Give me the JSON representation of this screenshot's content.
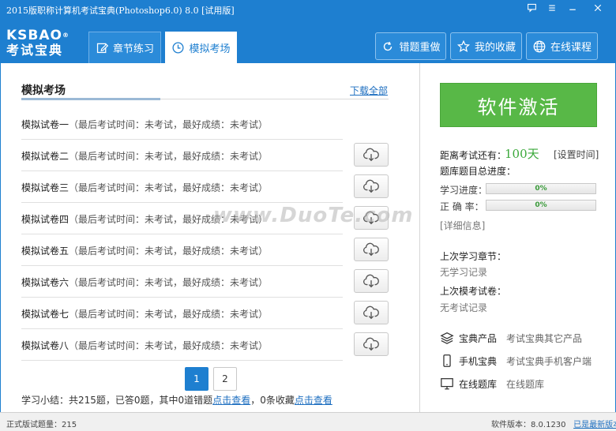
{
  "window": {
    "title": "2015版职称计算机考试宝典(Photoshop6.0) 8.0 [试用版]"
  },
  "logo": {
    "line1": "KSBAO",
    "line2": "考试宝典",
    "reg": "®"
  },
  "tabs": [
    {
      "label": "章节练习",
      "icon": "edit-icon",
      "active": false
    },
    {
      "label": "模拟考场",
      "icon": "clock-icon",
      "active": true
    }
  ],
  "header_buttons": [
    {
      "label": "错题重做",
      "icon": "refresh-icon"
    },
    {
      "label": "我的收藏",
      "icon": "star-icon"
    },
    {
      "label": "在线课程",
      "icon": "globe-icon"
    }
  ],
  "section": {
    "title": "模拟考场",
    "download_all": "下载全部"
  },
  "exams": [
    {
      "name": "模拟试卷一",
      "info": "（最后考试时间：未考试，最好成绩：未考试）",
      "download": false
    },
    {
      "name": "模拟试卷二",
      "info": "（最后考试时间：未考试，最好成绩：未考试）",
      "download": true
    },
    {
      "name": "模拟试卷三",
      "info": "（最后考试时间：未考试，最好成绩：未考试）",
      "download": true
    },
    {
      "name": "模拟试卷四",
      "info": "（最后考试时间：未考试，最好成绩：未考试）",
      "download": true
    },
    {
      "name": "模拟试卷五",
      "info": "（最后考试时间：未考试，最好成绩：未考试）",
      "download": true
    },
    {
      "name": "模拟试卷六",
      "info": "（最后考试时间：未考试，最好成绩：未考试）",
      "download": true
    },
    {
      "name": "模拟试卷七",
      "info": "（最后考试时间：未考试，最好成绩：未考试）",
      "download": true
    },
    {
      "name": "模拟试卷八",
      "info": "（最后考试时间：未考试，最好成绩：未考试）",
      "download": true
    }
  ],
  "pagination": {
    "pages": [
      "1",
      "2"
    ],
    "current": "1"
  },
  "summary": {
    "text1": "学习小结：共215题，已答0题，其中0道错题",
    "link1": "点击查看",
    "text2": "，0条收藏",
    "link2": "点击查看"
  },
  "right": {
    "activate_label": "软件激活",
    "countdown_label": "距离考试还有：",
    "countdown_value": "100天",
    "set_time": "[设置时间]",
    "progress_title": "题库题目总进度：",
    "study_label": "学习进度：",
    "study_value": "0%",
    "study_fraction": 0,
    "accuracy_label": "正  确  率：",
    "accuracy_value": "0%",
    "accuracy_fraction": 0,
    "detail_link": "[详细信息]",
    "last_chapter_label": "上次学习章节：",
    "last_chapter_value": "无学习记录",
    "last_exam_label": "上次模考试卷：",
    "last_exam_value": "无考试记录",
    "links": [
      {
        "key": "宝典产品",
        "value": "考试宝典其它产品",
        "icon": "layers-icon"
      },
      {
        "key": "手机宝典",
        "value": "考试宝典手机客户端",
        "icon": "phone-icon"
      },
      {
        "key": "在线题库",
        "value": "在线题库",
        "icon": "monitor-icon"
      }
    ]
  },
  "watermark": "www.DuoTe.com",
  "statusbar": {
    "left": "正式版试题量：215",
    "version": "软件版本：8.0.1230",
    "latest": "已是最新版本"
  },
  "colors": {
    "brand": "#1e7fd0",
    "activate": "#58b847",
    "link": "#1e6fc0"
  }
}
